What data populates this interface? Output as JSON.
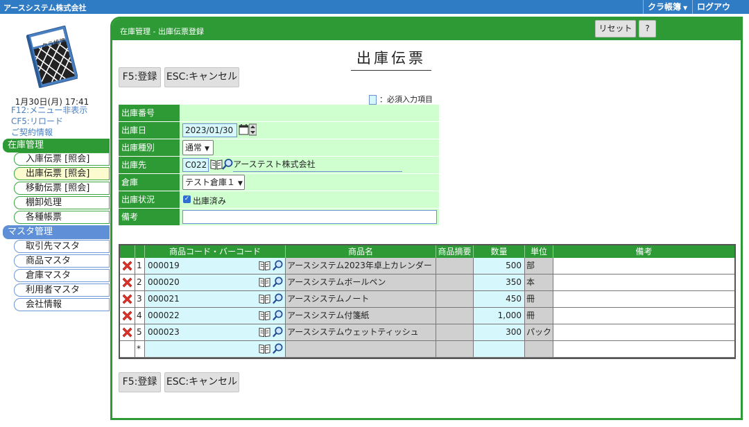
{
  "topbar": {
    "company": "アースシステム株式会社",
    "kura_menu": "クラ帳簿",
    "logout": "ログアウト"
  },
  "sidebar": {
    "logo_text": "クラ帳簿",
    "date": "1月30日(月) 17:41",
    "links": {
      "f12": "F12:メニュー非表示",
      "cf5": "CF5:リロード",
      "contract": "ご契約情報"
    },
    "inventory_section": "在庫管理",
    "inventory_items": [
      "入庫伝票 [照会]",
      "出庫伝票 [照会]",
      "移動伝票 [照会]",
      "棚卸処理",
      "各種帳票"
    ],
    "master_section": "マスタ管理",
    "master_items": [
      "取引先マスタ",
      "商品マスタ",
      "倉庫マスタ",
      "利用者マスタ",
      "会社情報"
    ]
  },
  "panel": {
    "title": "在庫管理 - 出庫伝票登録",
    "reset_label": "リセット",
    "help_label": "?",
    "doc_title": "出庫伝票",
    "register_label": "F5:登録",
    "cancel_label": "ESC:キャンセル",
    "required_note": "：必須入力項目"
  },
  "form": {
    "number_label": "出庫番号",
    "number_value": "",
    "date_label": "出庫日",
    "date_value": "2023/01/30",
    "type_label": "出庫種別",
    "type_value": "通常",
    "dest_label": "出庫先",
    "dest_code": "C022",
    "dest_name": "アーステスト株式会社",
    "warehouse_label": "倉庫",
    "warehouse_value": "テスト倉庫１",
    "status_label": "出庫状況",
    "status_checkbox_label": "出庫済み",
    "status_checked": true,
    "note_label": "備考",
    "note_value": ""
  },
  "grid": {
    "headers": {
      "code": "商品コード・バーコード",
      "name": "商品名",
      "summary": "商品摘要",
      "qty": "数量",
      "unit": "単位",
      "note": "備考"
    },
    "rows": [
      {
        "no": "1",
        "code": "000019",
        "name": "アースシステム2023年卓上カレンダー",
        "summary": "",
        "qty": "500",
        "unit": "部",
        "note": ""
      },
      {
        "no": "2",
        "code": "000020",
        "name": "アースシステムボールペン",
        "summary": "",
        "qty": "350",
        "unit": "本",
        "note": ""
      },
      {
        "no": "3",
        "code": "000021",
        "name": "アースシステムノート",
        "summary": "",
        "qty": "450",
        "unit": "冊",
        "note": ""
      },
      {
        "no": "4",
        "code": "000022",
        "name": "アースシステム付箋紙",
        "summary": "",
        "qty": "1,000",
        "unit": "冊",
        "note": ""
      },
      {
        "no": "5",
        "code": "000023",
        "name": "アースシステムウェットティッシュ",
        "summary": "",
        "qty": "300",
        "unit": "パック",
        "note": ""
      }
    ],
    "new_row_marker": "*"
  },
  "colors": {
    "topbar": "#2f7bc4",
    "green": "#2e9a36",
    "form_bg": "#cfffcf",
    "required_bg": "#d6f7fb"
  }
}
